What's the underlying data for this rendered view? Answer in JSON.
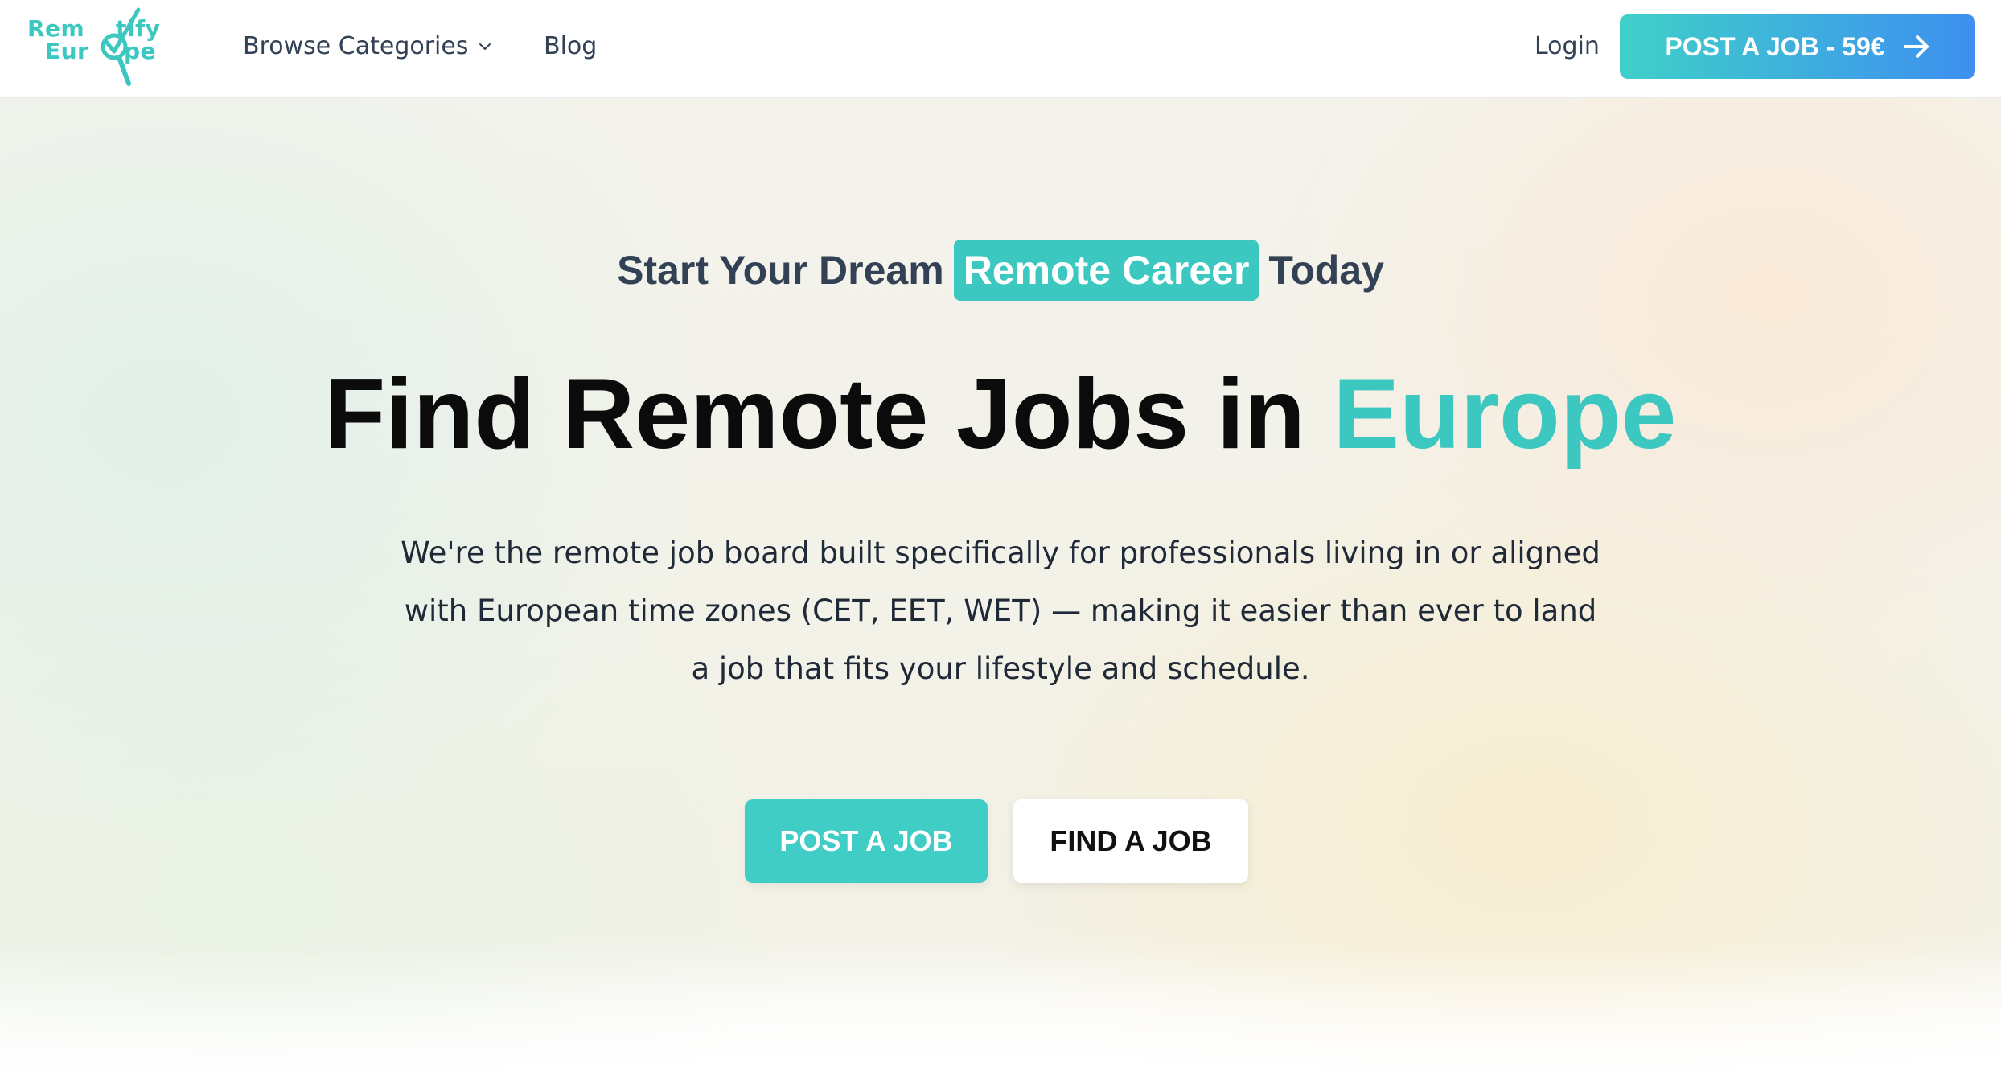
{
  "brand": {
    "logo_line1_a": "Rem",
    "logo_line1_b": "tify",
    "logo_line2_a": "Eur",
    "logo_line2_b": "pe",
    "accent_color": "#3cc7c0",
    "logo_mark_icon": "magnifier-check-icon"
  },
  "nav": {
    "browse_label": "Browse Categories",
    "browse_icon": "chevron-down-icon",
    "blog_label": "Blog",
    "login_label": "Login",
    "post_job_label": "POST A JOB - 59€",
    "post_job_icon": "arrow-right-icon",
    "post_job_gradient": [
      "#3fd0c9",
      "#3d8ff0"
    ]
  },
  "hero": {
    "tagline_before": "Start Your Dream",
    "tagline_highlight": "Remote Career",
    "tagline_after": "Today",
    "headline_main": "Find Remote Jobs in",
    "headline_accent": "Europe",
    "description": "We're the remote job board built specifically for professionals living in or aligned with European time zones (CET, EET, WET) — making it easier than ever to land a job that fits your lifestyle and schedule.",
    "cta_post_label": "POST A JOB",
    "cta_find_label": "FIND A JOB"
  }
}
